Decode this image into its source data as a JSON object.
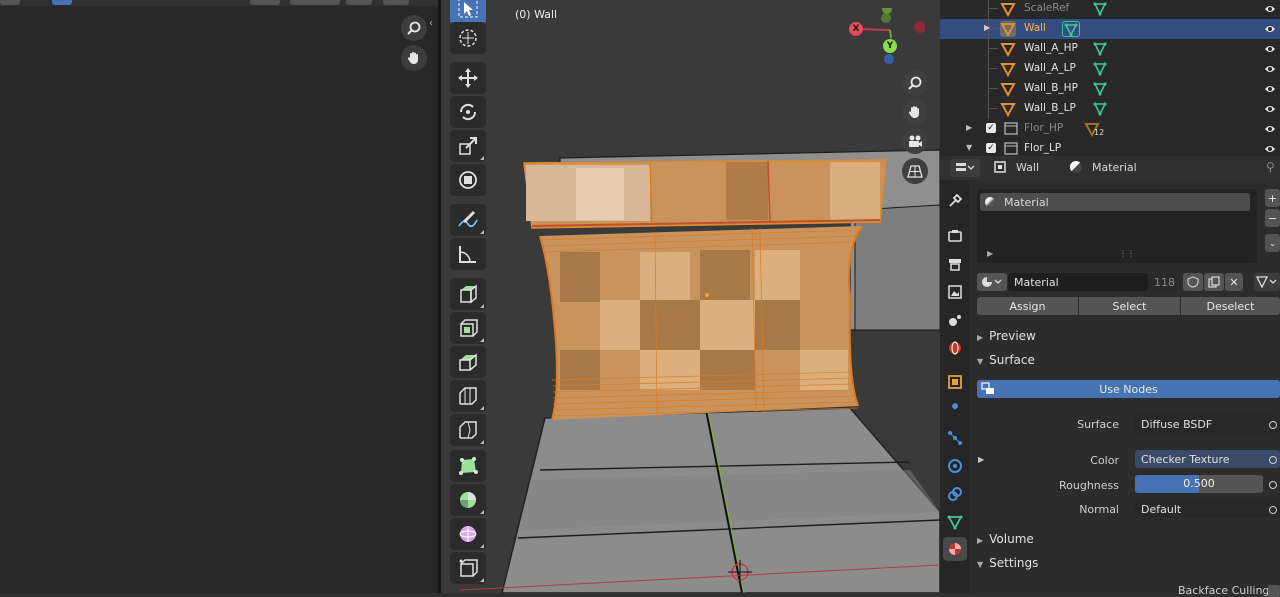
{
  "viewport": {
    "mode_label": "(0) Wall"
  },
  "gizmo": {
    "axis_x": "X",
    "axis_y": "Y"
  },
  "outliner": {
    "rows": [
      {
        "label": "ScaleRef",
        "indent": 2,
        "selected": false,
        "dim": true
      },
      {
        "label": "Wall",
        "indent": 2,
        "selected": true,
        "dim": false
      },
      {
        "label": "Wall_A_HP",
        "indent": 2,
        "selected": false,
        "dim": false
      },
      {
        "label": "Wall_A_LP",
        "indent": 2,
        "selected": false,
        "dim": false
      },
      {
        "label": "Wall_B_HP",
        "indent": 2,
        "selected": false,
        "dim": false
      },
      {
        "label": "Wall_B_LP",
        "indent": 2,
        "selected": false,
        "dim": false
      },
      {
        "label": "Flor_HP",
        "indent": 1,
        "selected": false,
        "dim": true,
        "badge": "12"
      },
      {
        "label": "Flor_LP",
        "indent": 1,
        "selected": false,
        "dim": false
      }
    ]
  },
  "properties": {
    "breadcrumb_object": "Wall",
    "breadcrumb_material": "Material",
    "slot_name": "Material",
    "material_name": "Material",
    "user_count": "118",
    "buttons": {
      "assign": "Assign",
      "select": "Select",
      "deselect": "Deselect"
    },
    "panels": {
      "preview": "Preview",
      "surface": "Surface",
      "volume": "Volume",
      "settings": "Settings"
    },
    "use_nodes": "Use Nodes",
    "surface": {
      "surface_label": "Surface",
      "surface_value": "Diffuse BSDF",
      "color_label": "Color",
      "color_value": "Checker Texture",
      "roughness_label": "Roughness",
      "roughness_value": "0.500",
      "roughness_fraction": 0.5,
      "normal_label": "Normal",
      "normal_value": "Default"
    },
    "backface_culling": "Backface Culling"
  },
  "colors": {
    "accent": "#4772b3",
    "selection": "#334d80",
    "object_orange": "#e08a2c",
    "mesh_green": "#47c7a4"
  }
}
